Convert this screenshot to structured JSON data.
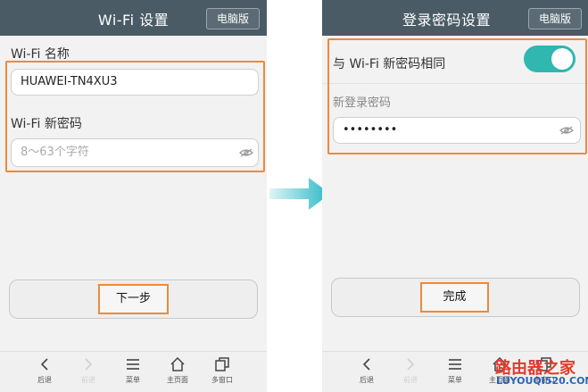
{
  "left": {
    "title": "Wi-Fi 设置",
    "pc_button": "电脑版",
    "wifi_name_label": "Wi-Fi 名称",
    "wifi_name_value": "HUAWEI-TN4XU3",
    "password_label": "Wi-Fi 新密码",
    "password_placeholder": "8～63个字符",
    "next_button": "下一步",
    "nav": [
      {
        "label": "后退",
        "icon": "chevron-left-icon"
      },
      {
        "label": "前进",
        "icon": "chevron-right-icon"
      },
      {
        "label": "菜单",
        "icon": "menu-icon"
      },
      {
        "label": "主页面",
        "icon": "home-icon"
      },
      {
        "label": "多窗口",
        "icon": "windows-icon"
      }
    ]
  },
  "right": {
    "title": "登录密码设置",
    "pc_button": "电脑版",
    "same_label": "与 Wi-Fi 新密码相同",
    "same_toggle_on": true,
    "login_password_label": "新登录密码",
    "login_password_value": "••••••••",
    "finish_button": "完成",
    "nav": [
      {
        "label": "后退",
        "icon": "chevron-left-icon"
      },
      {
        "label": "前进",
        "icon": "chevron-right-icon"
      },
      {
        "label": "菜单",
        "icon": "menu-icon"
      },
      {
        "label": "主页面",
        "icon": "home-icon"
      },
      {
        "label": "多窗口",
        "icon": "windows-icon"
      }
    ]
  },
  "watermark": {
    "brand": "路由器之家",
    "url": "LUYOUQI520.COM"
  },
  "colors": {
    "titlebar": "#4b5b66",
    "highlight": "#ee8a3a",
    "toggle": "#2fb7b0",
    "arrow": "#2bb8c6"
  }
}
